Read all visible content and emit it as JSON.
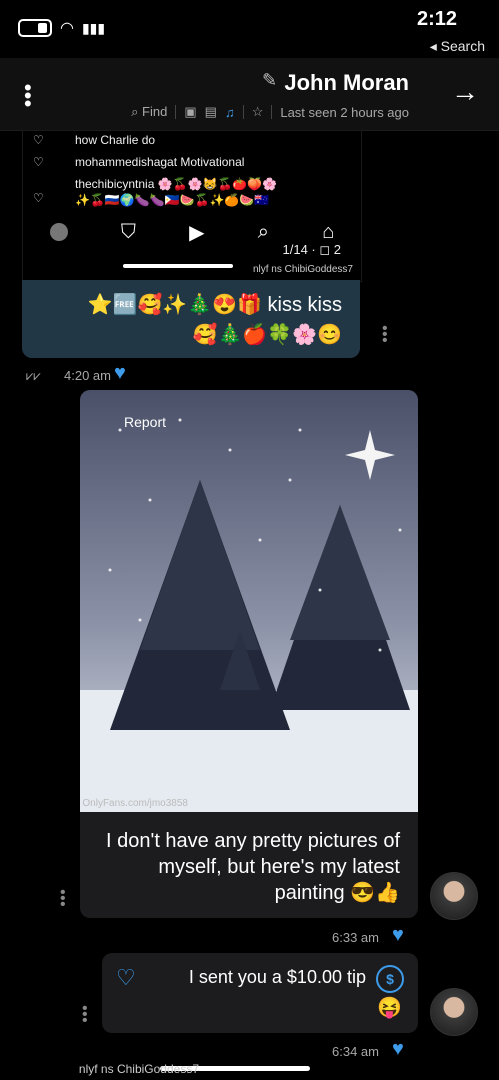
{
  "status": {
    "time": "2:12",
    "back_label": "◂ Search"
  },
  "header": {
    "name": "John Moran",
    "last_seen": "Last seen 2 hours ago",
    "find_label": "Find"
  },
  "shot": {
    "lines": [
      "how Charlie do",
      "mohammedishagat Motivational",
      "thechibicyntnia 🌸🍒🌸😸🍒🍅🍑🌸",
      "✨🍒🇷🇺🌍🍆🍆🇵🇭🍉🍒✨🍊🍉🇦🇺"
    ],
    "media_count": "1/14 · ◻ 2",
    "watermark": "nlyf  ns ChibiGoddess7"
  },
  "emoji_msg": {
    "line1": "⭐🆓🥰✨🎄😍🎁 kiss kiss",
    "line2": "🥰🎄🍎🍀🌸😊",
    "time": "4:20 am"
  },
  "paint_msg": {
    "report_label": "Report",
    "watermark": "OnlyFans.com/jmo3858",
    "text": "I don't have any pretty pictures of myself, but here's my latest painting 😎👍",
    "time": "6:33 am"
  },
  "tip_msg": {
    "text": "I sent you a $10.00 tip",
    "emoji": "😝",
    "time": "6:34 am"
  },
  "bottom": {
    "watermark": "nlyf  ns ChibiGoddess7"
  },
  "colors": {
    "accent": "#3d9be9",
    "bubble": "#1c1c1e",
    "emoji_bubble": "#223746"
  }
}
